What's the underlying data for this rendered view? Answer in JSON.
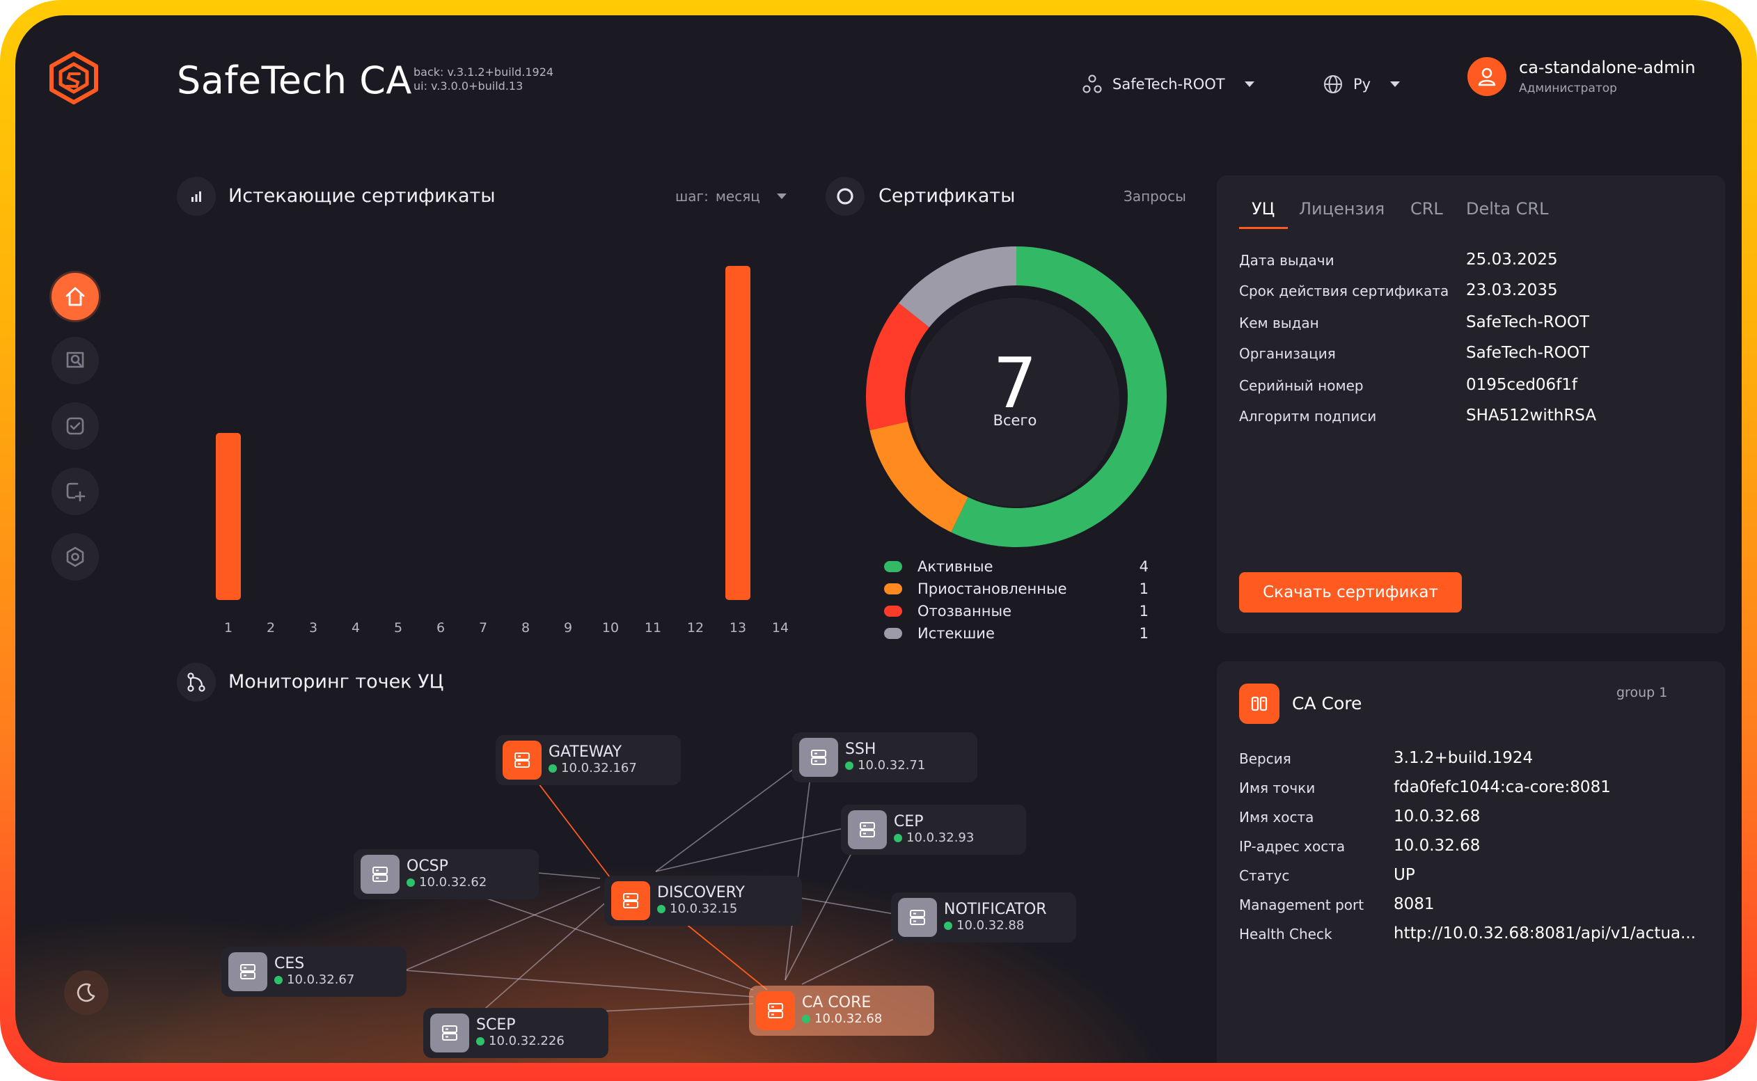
{
  "header": {
    "app_title": "SafeTech CA",
    "version_back": "back: v.3.1.2+build.1924",
    "version_ui": "ui: v.3.0.0+build.13",
    "org_selector": "SafeTech-ROOT",
    "lang_selector": "Ру",
    "user_name": "ca-standalone-admin",
    "user_role": "Администратор"
  },
  "sidebar": {
    "items": [
      {
        "icon": "home-icon",
        "active": true
      },
      {
        "icon": "search-certificate-icon",
        "active": false
      },
      {
        "icon": "check-square-icon",
        "active": false
      },
      {
        "icon": "add-request-icon",
        "active": false
      },
      {
        "icon": "settings-hexagon-icon",
        "active": false
      }
    ],
    "theme_icon": "moon-icon"
  },
  "expiring": {
    "title": "Истекающие сертификаты",
    "step_label": "шаг:",
    "step_value": "месяц"
  },
  "chart_data": {
    "type": "bar",
    "title": "Истекающие сертификаты",
    "categories": [
      "1",
      "2",
      "3",
      "4",
      "5",
      "6",
      "7",
      "8",
      "9",
      "10",
      "11",
      "12",
      "13",
      "14"
    ],
    "values": [
      1,
      0,
      0,
      0,
      0,
      0,
      0,
      0,
      0,
      0,
      0,
      0,
      2,
      0
    ],
    "ylim": [
      0,
      2
    ],
    "grid": false,
    "color": "#ff5a1f"
  },
  "certificates": {
    "title": "Сертификаты",
    "requests_link": "Запросы",
    "total": "7",
    "total_label": "Всего",
    "legend": [
      {
        "label": "Активные",
        "value": 4,
        "color": "#33b865"
      },
      {
        "label": "Приостановленные",
        "value": 1,
        "color": "#ff8a1f"
      },
      {
        "label": "Отозванные",
        "value": 1,
        "color": "#ff3b2a"
      },
      {
        "label": "Истекшие",
        "value": 1,
        "color": "#9e9ba9"
      }
    ]
  },
  "ca_info": {
    "tabs": [
      "УЦ",
      "Лицензия",
      "CRL",
      "Delta CRL"
    ],
    "rows": [
      {
        "key": "Дата выдачи",
        "value": "25.03.2025"
      },
      {
        "key": "Срок действия сертификата",
        "value": "23.03.2035"
      },
      {
        "key": "Кем выдан",
        "value": "SafeTech-ROOT"
      },
      {
        "key": "Организация",
        "value": "SafeTech-ROOT"
      },
      {
        "key": "Серийный номер",
        "value": "0195ced06f1f"
      },
      {
        "key": "Алгоритм подписи",
        "value": "SHA512withRSA"
      }
    ],
    "download_label": "Скачать сертификат"
  },
  "monitoring": {
    "title": "Мониторинг точек УЦ",
    "nodes": [
      {
        "name": "GATEWAY",
        "ip": "10.0.32.167",
        "accent": true
      },
      {
        "name": "SSH",
        "ip": "10.0.32.71",
        "accent": false
      },
      {
        "name": "CEP",
        "ip": "10.0.32.93",
        "accent": false
      },
      {
        "name": "OCSP",
        "ip": "10.0.32.62",
        "accent": false
      },
      {
        "name": "DISCOVERY",
        "ip": "10.0.32.15",
        "accent": true
      },
      {
        "name": "NOTIFICATOR",
        "ip": "10.0.32.88",
        "accent": false
      },
      {
        "name": "CES",
        "ip": "10.0.32.67",
        "accent": false
      },
      {
        "name": "CA CORE",
        "ip": "10.0.32.68",
        "accent": true
      },
      {
        "name": "SCEP",
        "ip": "10.0.32.226",
        "accent": false
      }
    ]
  },
  "node_details": {
    "title": "CA Core",
    "group": "group 1",
    "rows": [
      {
        "key": "Версия",
        "value": "3.1.2+build.1924"
      },
      {
        "key": "Имя точки",
        "value": "fda0fefc1044:ca-core:8081"
      },
      {
        "key": "Имя хоста",
        "value": "10.0.32.68"
      },
      {
        "key": "IP-адрес хоста",
        "value": "10.0.32.68"
      },
      {
        "key": "Статус",
        "value": "UP"
      },
      {
        "key": "Management port",
        "value": "8081"
      },
      {
        "key": "Health Check",
        "value": "http://10.0.32.68:8081/api/v1/actua..."
      }
    ]
  }
}
